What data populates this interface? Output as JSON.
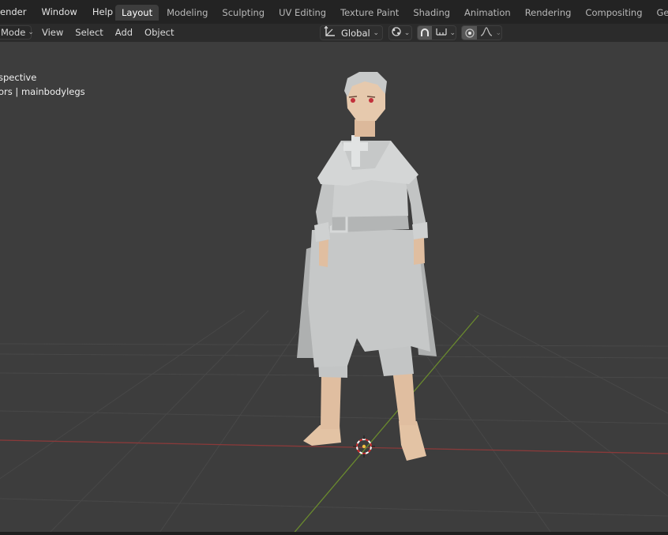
{
  "topbar": {
    "menu": [
      "ender",
      "Window",
      "Help"
    ],
    "workspaces": [
      "Layout",
      "Modeling",
      "Sculpting",
      "UV Editing",
      "Texture Paint",
      "Shading",
      "Animation",
      "Rendering",
      "Compositing",
      "Geomet"
    ],
    "active_workspace": "Layout"
  },
  "header": {
    "mode_label": "Mode",
    "menu": [
      "View",
      "Select",
      "Add",
      "Object"
    ],
    "orientation_label": "Global",
    "icons": {
      "orientation": "transform-orientation-icon",
      "pivot": "pivot-point-icon",
      "snap": "snap-magnet-icon",
      "snap_target": "snap-increment-icon",
      "proportional": "proportional-editing-icon",
      "falloff": "falloff-curve-icon"
    }
  },
  "viewport": {
    "overlay_line1": "spective",
    "overlay_line2": "ors | mainbodylegs",
    "colors": {
      "background": "#3d3d3d",
      "x_axis": "#8a3a3a",
      "y_axis": "#6a8a2e",
      "grid": "#474747",
      "model": "#c9cbcb",
      "skin": "#e3c3a4"
    }
  }
}
